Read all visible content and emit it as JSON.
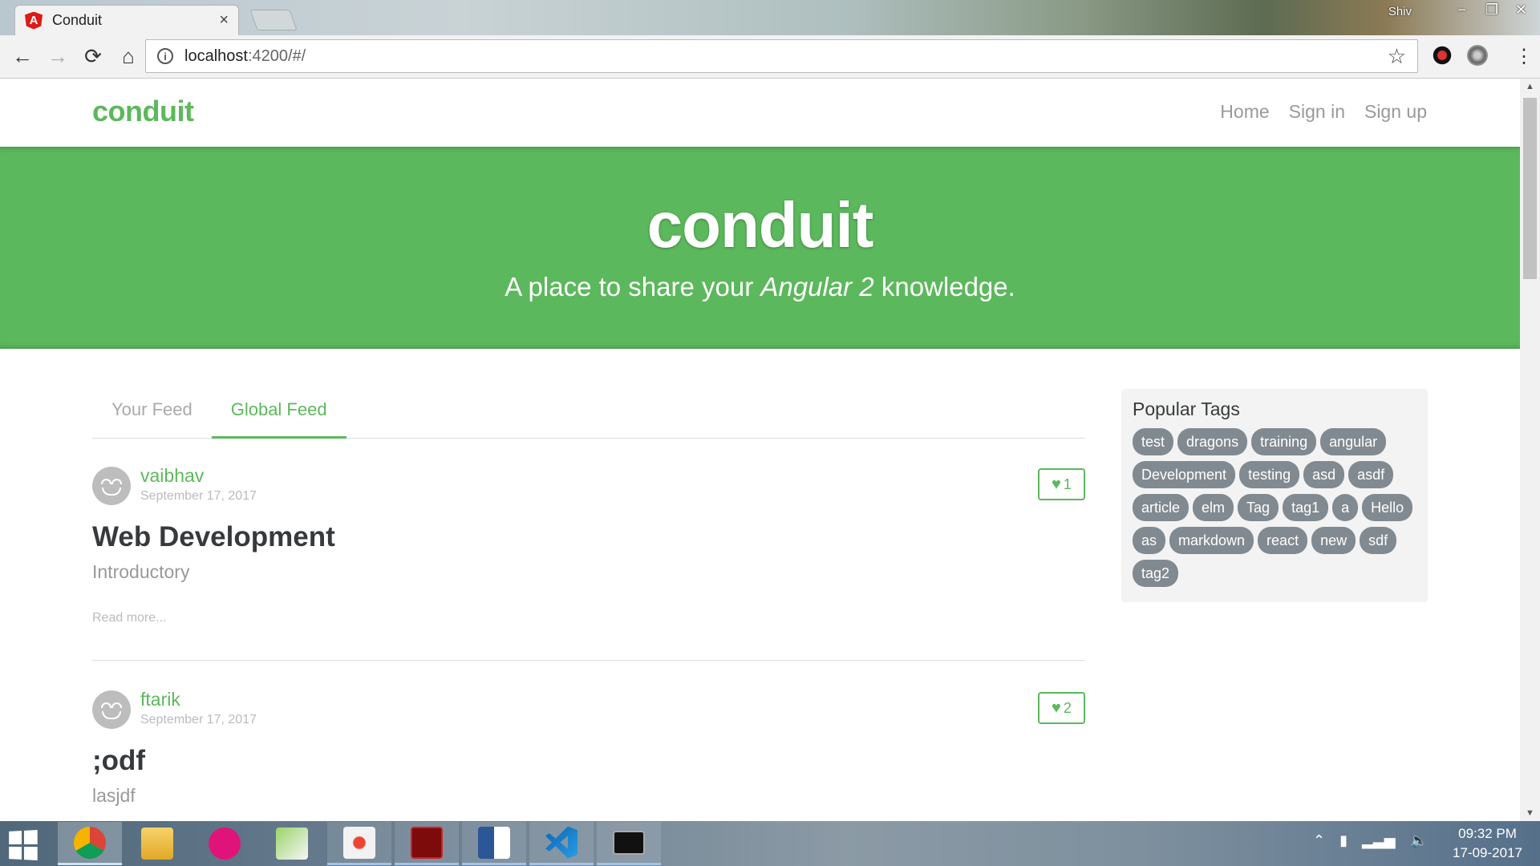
{
  "browser": {
    "tab_title": "Conduit",
    "tab_close": "×",
    "window_user": "Shiv",
    "url_host": "localhost",
    "url_rest": ":4200/#/"
  },
  "app": {
    "brand": "conduit",
    "nav": [
      "Home",
      "Sign in",
      "Sign up"
    ],
    "banner": {
      "title": "conduit",
      "subtitle_pre": "A place to share your ",
      "subtitle_em": "Angular 2",
      "subtitle_post": " knowledge."
    },
    "feed_tabs": [
      "Your Feed",
      "Global Feed"
    ],
    "articles": [
      {
        "author": "vaibhav",
        "date": "September 17, 2017",
        "likes": "1",
        "title": "Web Development",
        "description": "Introductory",
        "read_more": "Read more..."
      },
      {
        "author": "ftarik",
        "date": "September 17, 2017",
        "likes": "2",
        "title": ";odf",
        "description": "lasjdf"
      }
    ],
    "sidebar": {
      "title": "Popular Tags",
      "tags": [
        "test",
        "dragons",
        "training",
        "angular",
        "Development",
        "testing",
        "asd",
        "asdf",
        "article",
        "elm",
        "Tag",
        "tag1",
        "a",
        "Hello",
        "as",
        "markdown",
        "react",
        "new",
        "sdf",
        "tag2"
      ]
    }
  },
  "taskbar": {
    "time": "09:32 PM",
    "date": "17-09-2017"
  },
  "colors": {
    "brand_green": "#5cb85c",
    "tag_gray": "#818a91"
  }
}
